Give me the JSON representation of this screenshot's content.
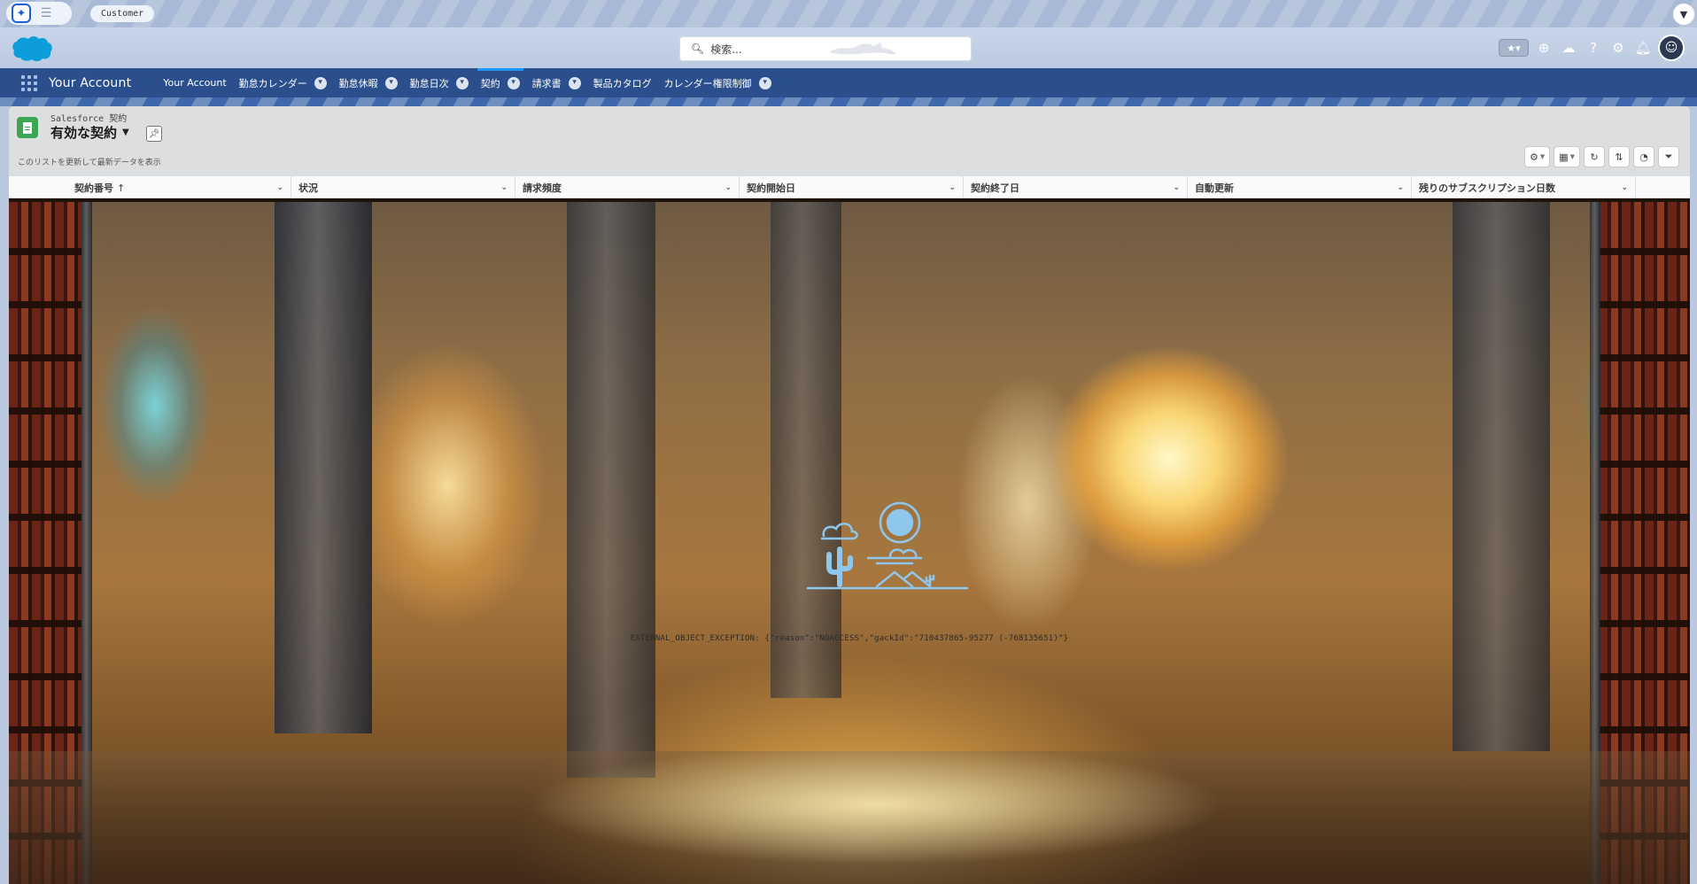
{
  "browser": {
    "tab_label": "Customer"
  },
  "header": {
    "search_placeholder": "検索...",
    "icons": [
      "favorites-icon",
      "add-icon",
      "cloud-icon",
      "help-icon",
      "settings-icon",
      "bell-icon",
      "avatar-icon"
    ]
  },
  "nav": {
    "app_name": "Your Account",
    "items": [
      {
        "label": "Your Account",
        "has_menu": false
      },
      {
        "label": "勤怠カレンダー",
        "has_menu": true
      },
      {
        "label": "勤怠休暇",
        "has_menu": true
      },
      {
        "label": "勤怠日次",
        "has_menu": true
      },
      {
        "label": "契約",
        "has_menu": true,
        "active": true
      },
      {
        "label": "請求書",
        "has_menu": true
      },
      {
        "label": "製品カタログ",
        "has_menu": false
      },
      {
        "label": "カレンダー権限制御",
        "has_menu": true
      }
    ]
  },
  "list_view": {
    "object_label": "Salesforce 契約",
    "title": "有効な契約",
    "refresh_hint": "このリストを更新して最新データを表示",
    "columns": [
      {
        "label": "契約番号",
        "sorted": "↑"
      },
      {
        "label": "状況"
      },
      {
        "label": "請求頻度"
      },
      {
        "label": "契約開始日"
      },
      {
        "label": "契約終了日"
      },
      {
        "label": "自動更新"
      },
      {
        "label": "残りのサブスクリプション日数"
      }
    ],
    "error_message": "EXTERNAL_OBJECT_EXCEPTION: {\"reason\":\"NOACCESS\",\"gackId\":\"710437865-95277 (-768135651)\"}"
  },
  "colors": {
    "nav_bg": "#2a4f8c",
    "accent": "#1b96ff",
    "object_icon": "#3ba755",
    "illustration": "#8ec6ec"
  }
}
